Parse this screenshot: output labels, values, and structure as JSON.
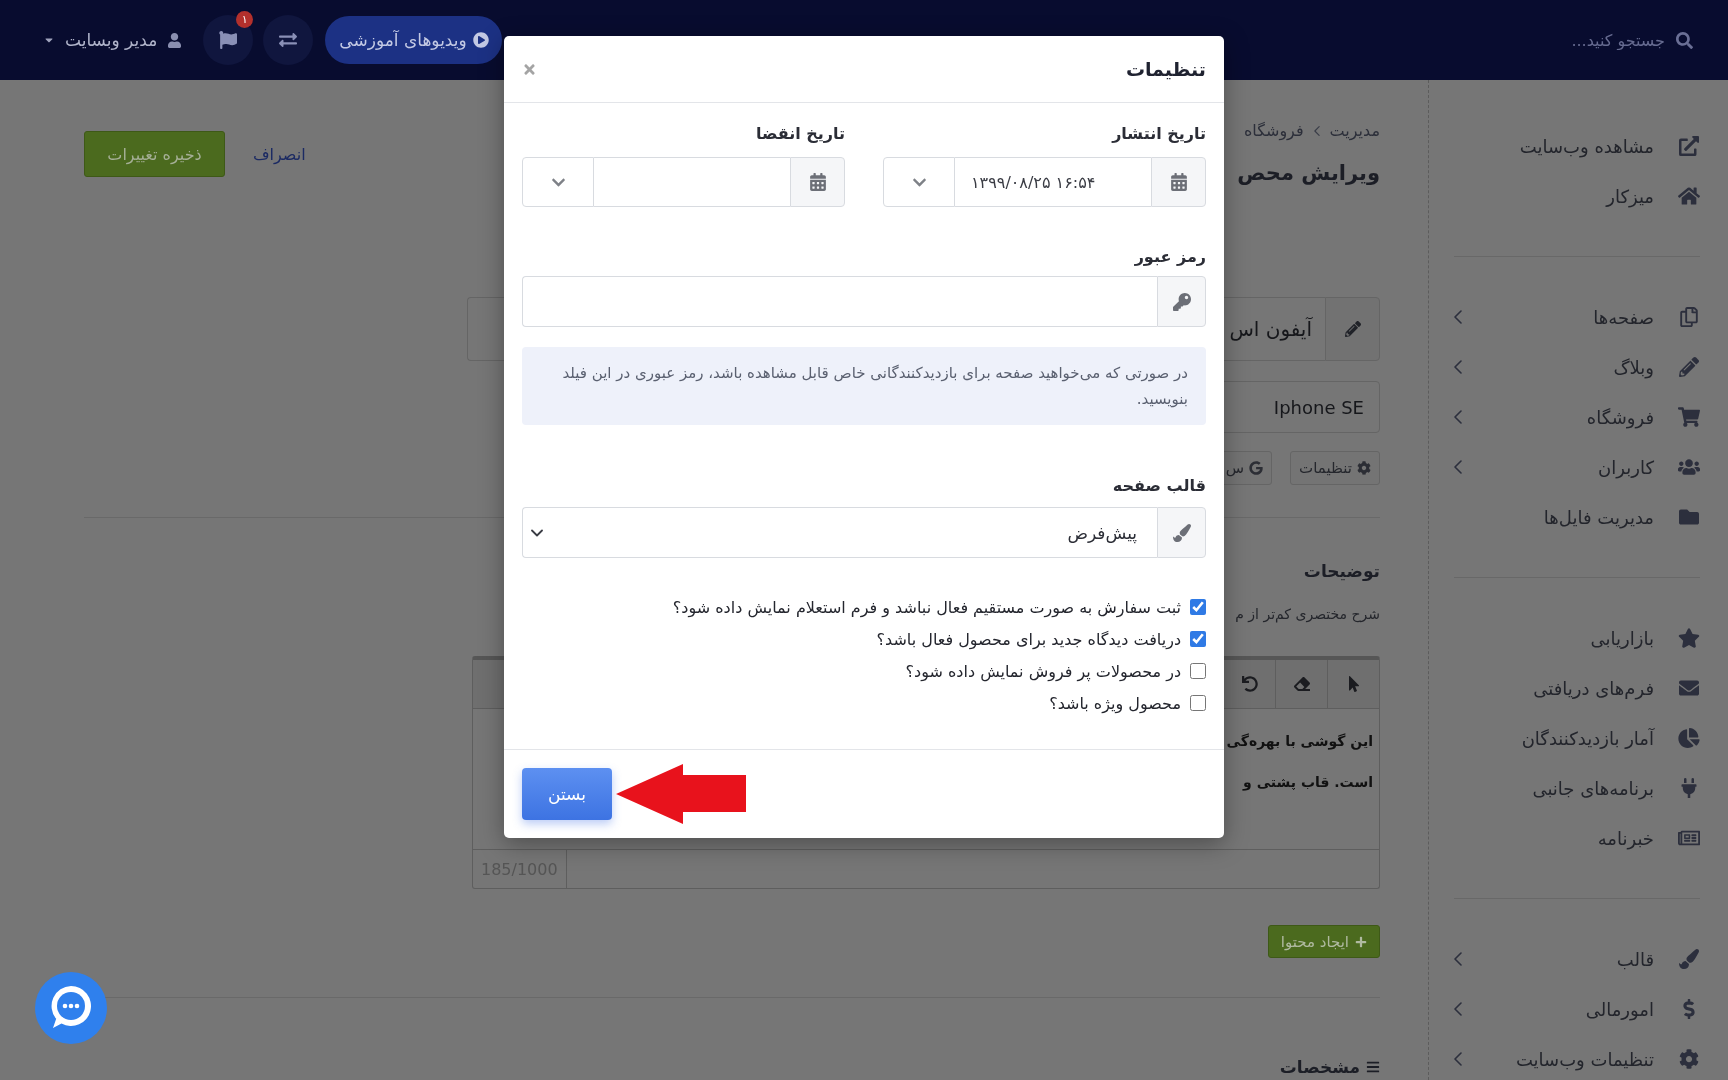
{
  "topbar": {
    "search": {
      "placeholder": "جستجو کنید..."
    },
    "tutorial_button": "ویدیوهای آموزشی",
    "notification_badge": "۱",
    "user_menu": "مدیر وبسایت"
  },
  "sidebar": {
    "groups": [
      {
        "items": [
          {
            "label": "مشاهده وب‌سایت",
            "expandable": false
          },
          {
            "label": "میزکار",
            "expandable": false
          }
        ]
      },
      {
        "items": [
          {
            "label": "صفحه‌ها",
            "expandable": true
          },
          {
            "label": "وبلاگ",
            "expandable": true
          },
          {
            "label": "فروشگاه",
            "expandable": true
          },
          {
            "label": "کاربران",
            "expandable": true
          },
          {
            "label": "مدیریت فایل‌ها",
            "expandable": false
          }
        ]
      },
      {
        "items": [
          {
            "label": "بازاریابی",
            "expandable": false
          },
          {
            "label": "فرم‌های دریافتی",
            "expandable": false
          },
          {
            "label": "آمار بازدیدکنندگان",
            "expandable": false
          },
          {
            "label": "برنامه‌های جانبی",
            "expandable": false
          },
          {
            "label": "خبرنامه",
            "expandable": false
          }
        ]
      },
      {
        "items": [
          {
            "label": "قالب",
            "expandable": true
          },
          {
            "label": "امورمالی",
            "expandable": true
          },
          {
            "label": "تنظیمات وب‌سایت",
            "expandable": true
          }
        ]
      }
    ]
  },
  "page": {
    "breadcrumb": [
      "مدیریت",
      "فروشگاه"
    ],
    "title": "ویرایش محص",
    "actions": {
      "cancel": "انصراف",
      "save": "ذخیره تغییرات"
    },
    "product_name": {
      "value": "آیفون اس"
    },
    "slug": {
      "value": "Iphone SE"
    },
    "tool_buttons": [
      {
        "kind": "gear",
        "label": "تنظیمات"
      },
      {
        "kind": "g_logo",
        "label": "س"
      }
    ],
    "description": {
      "heading": "توضیحات",
      "hint": "شرح مختصری کم‌تر از م",
      "editor_lines": [
        "این گوشی با بهره‌گی",
        "است. قاب پشتی و"
      ],
      "counter": "185/1000"
    },
    "create_content_button": "ایجاد محتوا",
    "specs_heading": "مشخصات"
  },
  "modal": {
    "title": "تنظیمات",
    "publish_date": {
      "label": "تاریخ انتشار",
      "value": "۱۳۹۹/۰۸/۲۵ ۱۶:۵۴"
    },
    "expiry_date": {
      "label": "تاریخ انقضا"
    },
    "password": {
      "label": "رمز عبور"
    },
    "password_hint": "در صورتی که می‌خواهید صفحه برای بازدیدکنندگانی خاص قابل مشاهده باشد، رمز عبوری در این فیلد بنویسید.",
    "template": {
      "label": "قالب صفحه",
      "value": "پیش‌فرض"
    },
    "options": [
      {
        "label": "ثبت سفارش به صورت مستقیم فعال نباشد و فرم استعلام نمایش داده شود؟",
        "checked": true
      },
      {
        "label": "دریافت دیدگاه جدید برای محصول فعال باشد؟",
        "checked": true
      },
      {
        "label": "در محصولات پر فروش نمایش داده شود؟",
        "checked": false
      },
      {
        "label": "محصول ویژه باشد؟",
        "checked": false
      }
    ],
    "close_button": "بستن"
  }
}
